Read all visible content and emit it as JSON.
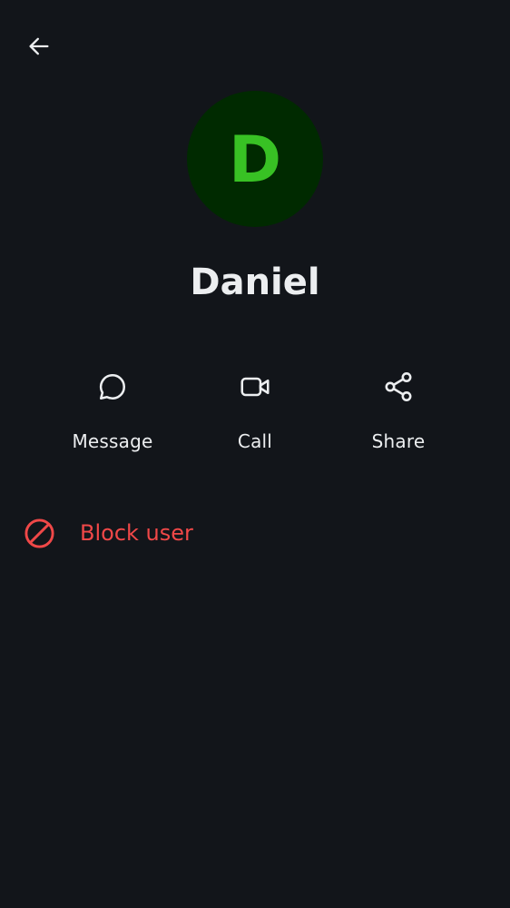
{
  "header": {
    "back_icon": "arrow-left-icon"
  },
  "contact": {
    "avatar_letter": "D",
    "name": "Daniel",
    "avatar_bg_color": "#002a00",
    "avatar_text_color": "#38c124"
  },
  "actions": [
    {
      "icon": "chat-bubble-icon",
      "label": "Message"
    },
    {
      "icon": "video-camera-icon",
      "label": "Call"
    },
    {
      "icon": "share-icon",
      "label": "Share"
    }
  ],
  "block": {
    "icon": "block-icon",
    "label": "Block user",
    "color": "#f04848"
  },
  "theme": {
    "background": "#12151a",
    "text": "#eceef0"
  }
}
